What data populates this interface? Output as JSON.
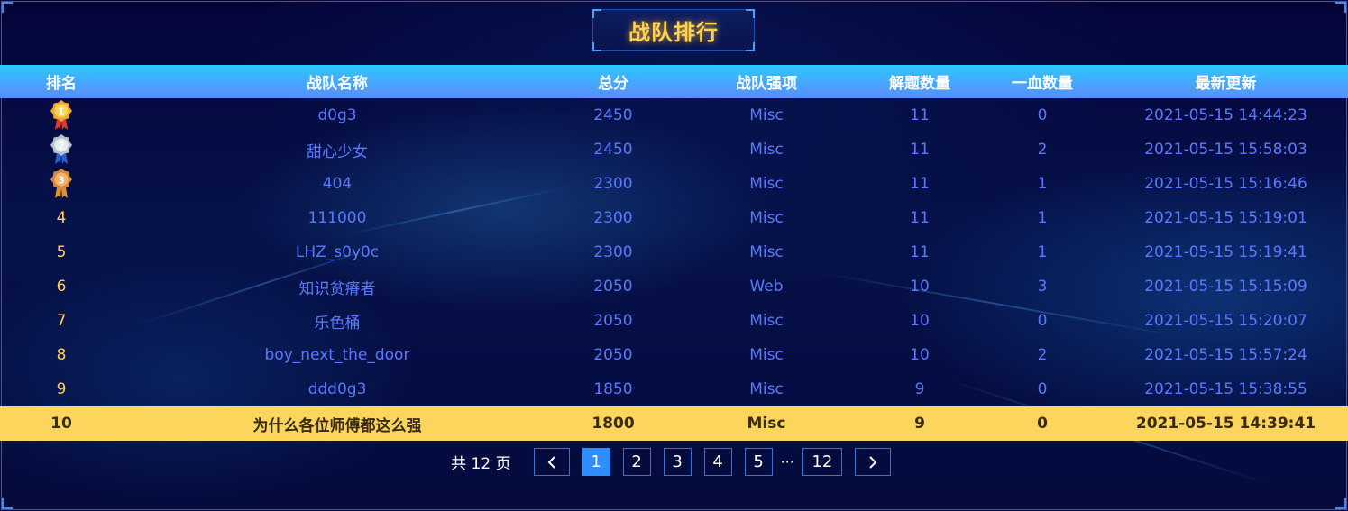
{
  "title": "战队排行",
  "headers": {
    "rank": "排名",
    "name": "战队名称",
    "score": "总分",
    "skill": "战队强项",
    "solved": "解题数量",
    "blood": "一血数量",
    "time": "最新更新"
  },
  "rows": [
    {
      "rank": "1",
      "name": "d0g3",
      "score": "2450",
      "skill": "Misc",
      "solved": "11",
      "blood": "0",
      "time": "2021-05-15 14:44:23",
      "medal": "gold"
    },
    {
      "rank": "2",
      "name": "甜心少女",
      "score": "2450",
      "skill": "Misc",
      "solved": "11",
      "blood": "2",
      "time": "2021-05-15 15:58:03",
      "medal": "silver"
    },
    {
      "rank": "3",
      "name": "404",
      "score": "2300",
      "skill": "Misc",
      "solved": "11",
      "blood": "1",
      "time": "2021-05-15 15:16:46",
      "medal": "bronze"
    },
    {
      "rank": "4",
      "name": "111000",
      "score": "2300",
      "skill": "Misc",
      "solved": "11",
      "blood": "1",
      "time": "2021-05-15 15:19:01"
    },
    {
      "rank": "5",
      "name": "LHZ_s0y0c",
      "score": "2300",
      "skill": "Misc",
      "solved": "11",
      "blood": "1",
      "time": "2021-05-15 15:19:41"
    },
    {
      "rank": "6",
      "name": "知识贫瘠者",
      "score": "2050",
      "skill": "Web",
      "solved": "10",
      "blood": "3",
      "time": "2021-05-15 15:15:09"
    },
    {
      "rank": "7",
      "name": "乐色桶",
      "score": "2050",
      "skill": "Misc",
      "solved": "10",
      "blood": "0",
      "time": "2021-05-15 15:20:07"
    },
    {
      "rank": "8",
      "name": "boy_next_the_door",
      "score": "2050",
      "skill": "Misc",
      "solved": "10",
      "blood": "2",
      "time": "2021-05-15 15:57:24"
    },
    {
      "rank": "9",
      "name": "ddd0g3",
      "score": "1850",
      "skill": "Misc",
      "solved": "9",
      "blood": "0",
      "time": "2021-05-15 15:38:55"
    },
    {
      "rank": "10",
      "name": "为什么各位师傅都这么强",
      "score": "1800",
      "skill": "Misc",
      "solved": "9",
      "blood": "0",
      "time": "2021-05-15 14:39:41",
      "highlight": true
    }
  ],
  "pagination": {
    "total_label": "共 12 页",
    "prev": "<",
    "next": ">",
    "pages": [
      "1",
      "2",
      "3",
      "4",
      "5"
    ],
    "ellipsis": "···",
    "last": "12",
    "current": "1"
  },
  "colors": {
    "accent": "#ffd34d",
    "text": "#5b78ff",
    "header_gradient_top": "#2ec8ff",
    "header_gradient_bottom": "#5b8cff",
    "highlight_row": "#fcd65c",
    "active_page": "#2e8dff"
  }
}
